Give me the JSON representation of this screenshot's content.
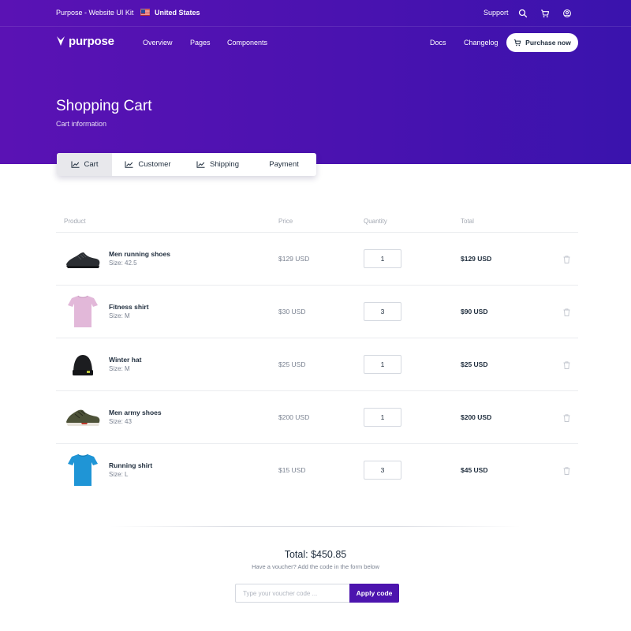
{
  "topbar": {
    "title": "Purpose - Website UI Kit",
    "country": "United States",
    "support": "Support"
  },
  "navbar": {
    "brand": "purpose",
    "links": [
      "Overview",
      "Pages",
      "Components"
    ],
    "right_links": [
      "Docs",
      "Changelog"
    ],
    "purchase_label": "Purchase now"
  },
  "header": {
    "title": "Shopping Cart",
    "subtitle": "Cart information"
  },
  "tabs": [
    {
      "label": "Cart",
      "active": true,
      "icon": "chart-line-icon"
    },
    {
      "label": "Customer",
      "active": false,
      "icon": "chart-line-icon"
    },
    {
      "label": "Shipping",
      "active": false,
      "icon": "chart-line-icon"
    },
    {
      "label": "Payment",
      "active": false
    }
  ],
  "table": {
    "columns": [
      "Product",
      "Price",
      "Quantity",
      "Total"
    ],
    "rows": [
      {
        "name": "Men running shoes",
        "size": "Size: 42.5",
        "price": "$129 USD",
        "qty": "1",
        "total": "$129 USD",
        "image": "running-shoe"
      },
      {
        "name": "Fitness shirt",
        "size": "Size: M",
        "price": "$30 USD",
        "qty": "3",
        "total": "$90 USD",
        "image": "pink-shirt"
      },
      {
        "name": "Winter hat",
        "size": "Size: M",
        "price": "$25 USD",
        "qty": "1",
        "total": "$25 USD",
        "image": "beanie"
      },
      {
        "name": "Men army shoes",
        "size": "Size: 43",
        "price": "$200 USD",
        "qty": "1",
        "total": "$200 USD",
        "image": "army-shoe"
      },
      {
        "name": "Running shirt",
        "size": "Size: L",
        "price": "$15 USD",
        "qty": "3",
        "total": "$45 USD",
        "image": "blue-shirt"
      }
    ]
  },
  "summary": {
    "total": "Total: $450.85",
    "voucher_hint": "Have a voucher? Add the code in the form below",
    "voucher_placeholder": "Type your voucher code ...",
    "apply_label": "Apply code"
  },
  "colors": {
    "brand": "#4c14ae",
    "hero_start": "#5a12b4",
    "hero_end": "#3a13ad"
  }
}
